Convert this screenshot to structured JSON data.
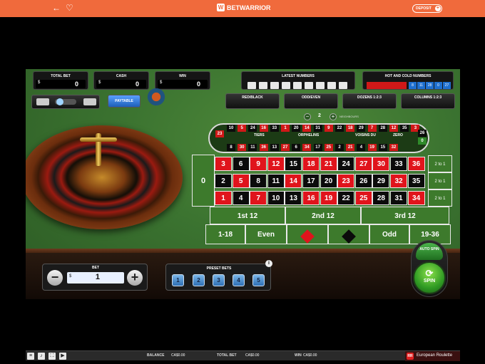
{
  "topbar": {
    "back_icon": "back-arrow-icon",
    "fav_icon": "heart-icon",
    "brand": "BETWARRIOR",
    "deposit_label": "DEPOSIT"
  },
  "stats": {
    "total_bet": {
      "label": "TOTAL BET",
      "currency": "$",
      "value": "0"
    },
    "cash": {
      "label": "CASH",
      "currency": "$",
      "value": "0"
    },
    "win": {
      "label": "WIN",
      "currency": "$",
      "value": "0"
    }
  },
  "latest_numbers_label": "LATEST NUMBERS",
  "hot_cold": {
    "label": "HOT AND COLD NUMBERS",
    "numbers": [
      "8",
      "11",
      "28",
      "0",
      "27"
    ]
  },
  "bet_types": [
    "RED/BLACK",
    "ODD/EVEN",
    "DOZENS 1:2:3",
    "COLUMNS 1:2:3"
  ],
  "paytable_label": "PAYTABLE",
  "neighbours": {
    "count": "2",
    "label": "NEIGHBOURS"
  },
  "racetrack": {
    "top": [
      "10",
      "5",
      "24",
      "16",
      "33",
      "1",
      "20",
      "14",
      "31",
      "9",
      "22",
      "18",
      "29",
      "7",
      "28",
      "12",
      "35",
      "3"
    ],
    "bottom": [
      "8",
      "30",
      "11",
      "36",
      "13",
      "27",
      "6",
      "34",
      "17",
      "25",
      "2",
      "21",
      "4",
      "19",
      "15",
      "32"
    ],
    "left": [
      "23"
    ],
    "right": [
      "26",
      "0"
    ],
    "sections": [
      "TIERS",
      "ORPHELINS",
      "VOISINS DU",
      "ZERO"
    ]
  },
  "table": {
    "zero": "0",
    "rows": [
      [
        "3",
        "6",
        "9",
        "12",
        "15",
        "18",
        "21",
        "24",
        "27",
        "30",
        "33",
        "36"
      ],
      [
        "2",
        "5",
        "8",
        "11",
        "14",
        "17",
        "20",
        "23",
        "26",
        "29",
        "32",
        "35"
      ],
      [
        "1",
        "4",
        "7",
        "10",
        "13",
        "16",
        "19",
        "22",
        "25",
        "28",
        "31",
        "34"
      ]
    ],
    "column_bets": [
      "2 to 1",
      "2 to 1",
      "2 to 1"
    ],
    "dozens": [
      "1st 12",
      "2nd 12",
      "3rd 12"
    ],
    "outside": [
      "1-18",
      "Even",
      "Odd",
      "19-36"
    ]
  },
  "bet": {
    "label": "BET",
    "currency": "$",
    "value": "1"
  },
  "preset_bets": {
    "label": "PRESET BETS",
    "values": [
      "1",
      "2",
      "3",
      "4",
      "5"
    ]
  },
  "autospin_label": "AUTO SPIN",
  "spin_label": "SPIN",
  "bottom": {
    "balance_label": "BALANCE",
    "balance": "CA$0.00",
    "total_bet_label": "TOTAL BET",
    "total_bet": "CA$0.00",
    "win_label": "WIN",
    "win": "CA$0.00",
    "game_name": "European Roulette"
  },
  "colors": {
    "accent": "#f06a3c",
    "felt": "#3b7330",
    "red": "#e0141c",
    "black": "#0b0b0b"
  }
}
